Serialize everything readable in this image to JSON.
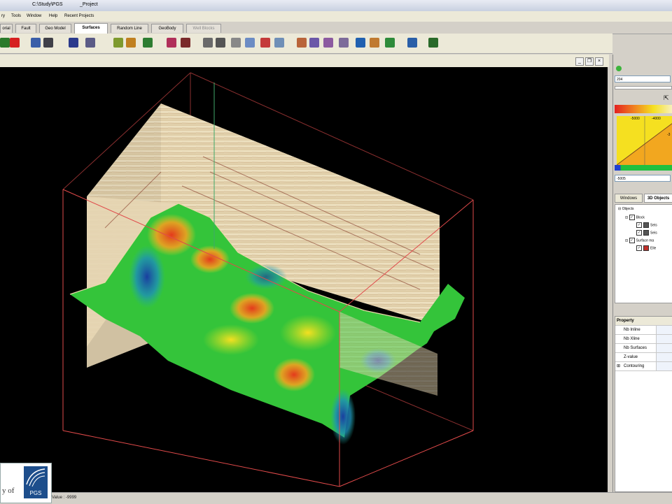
{
  "window": {
    "title_path": "C:\\Study\\PGS",
    "title_project": "_Project"
  },
  "menu": [
    "ry",
    "Tools",
    "Window",
    "Help",
    "Recent Projects"
  ],
  "tabs": [
    {
      "label": "orial",
      "state": "normal"
    },
    {
      "label": "Fault",
      "state": "normal"
    },
    {
      "label": "Geo Model",
      "state": "normal"
    },
    {
      "label": "Surfaces",
      "state": "active"
    },
    {
      "label": "Random Line",
      "state": "normal"
    },
    {
      "label": "GeoBody",
      "state": "normal"
    },
    {
      "label": "Well Blocks",
      "state": "disabled"
    }
  ],
  "viewer": {
    "minimize": "_",
    "restore": "❐",
    "close": "×"
  },
  "right_panel": {
    "value_field": "204",
    "color_labels": [
      "-5000",
      "-4000",
      "-3"
    ],
    "min_field": "-5005",
    "tabs": [
      "Windows",
      "3D Objects"
    ],
    "tree": {
      "root": "Objects",
      "block": "Block",
      "block_children": [
        "Seis",
        "Seis"
      ],
      "surface": "Surface ma",
      "surface_child": "Elle"
    },
    "properties": {
      "header": "Property",
      "rows": [
        "Nb Inline",
        "Nb Xline",
        "Nb Surfaces",
        "Z-value",
        "Contouring"
      ]
    }
  },
  "status": {
    "text": "Value : -9999"
  },
  "logo": {
    "prefix": "y of",
    "brand": "PGS"
  },
  "colors": {
    "viewport_bg": "#000000",
    "box_wire": "#e04a4a",
    "box_wire_dark": "#8a2f2f",
    "accent_green": "#3cb43c"
  }
}
